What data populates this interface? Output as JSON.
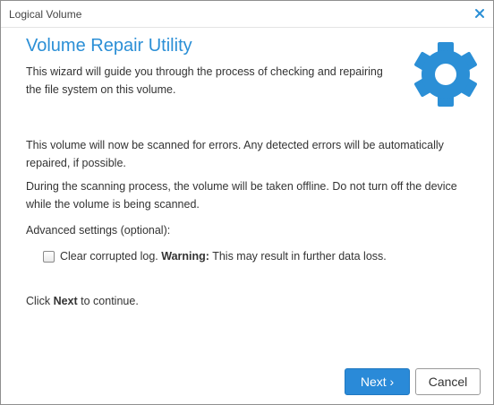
{
  "window": {
    "title": "Logical Volume",
    "close_icon": "close-icon"
  },
  "header": {
    "title": "Volume Repair Utility",
    "intro": "This wizard will guide you through the process of checking and repairing the file system on this volume.",
    "icon": "gear-icon"
  },
  "body": {
    "paragraph1": "This volume will now be scanned for errors. Any detected errors will be automatically repaired, if possible.",
    "paragraph2": "During the scanning process, the volume will be taken offline. Do not turn off the device while the volume is being scanned.",
    "advanced_label": "Advanced settings (optional):",
    "checkbox": {
      "label_prefix": "Clear corrupted log.",
      "warning_label": "Warning:",
      "warning_text": "This may result in further data loss.",
      "checked": false
    },
    "continue_prefix": "Click",
    "continue_bold": "Next",
    "continue_suffix": "to continue."
  },
  "footer": {
    "next_label": "Next ›",
    "cancel_label": "Cancel"
  },
  "colors": {
    "accent": "#2b8fd6",
    "button_primary": "#2a8ad8"
  }
}
